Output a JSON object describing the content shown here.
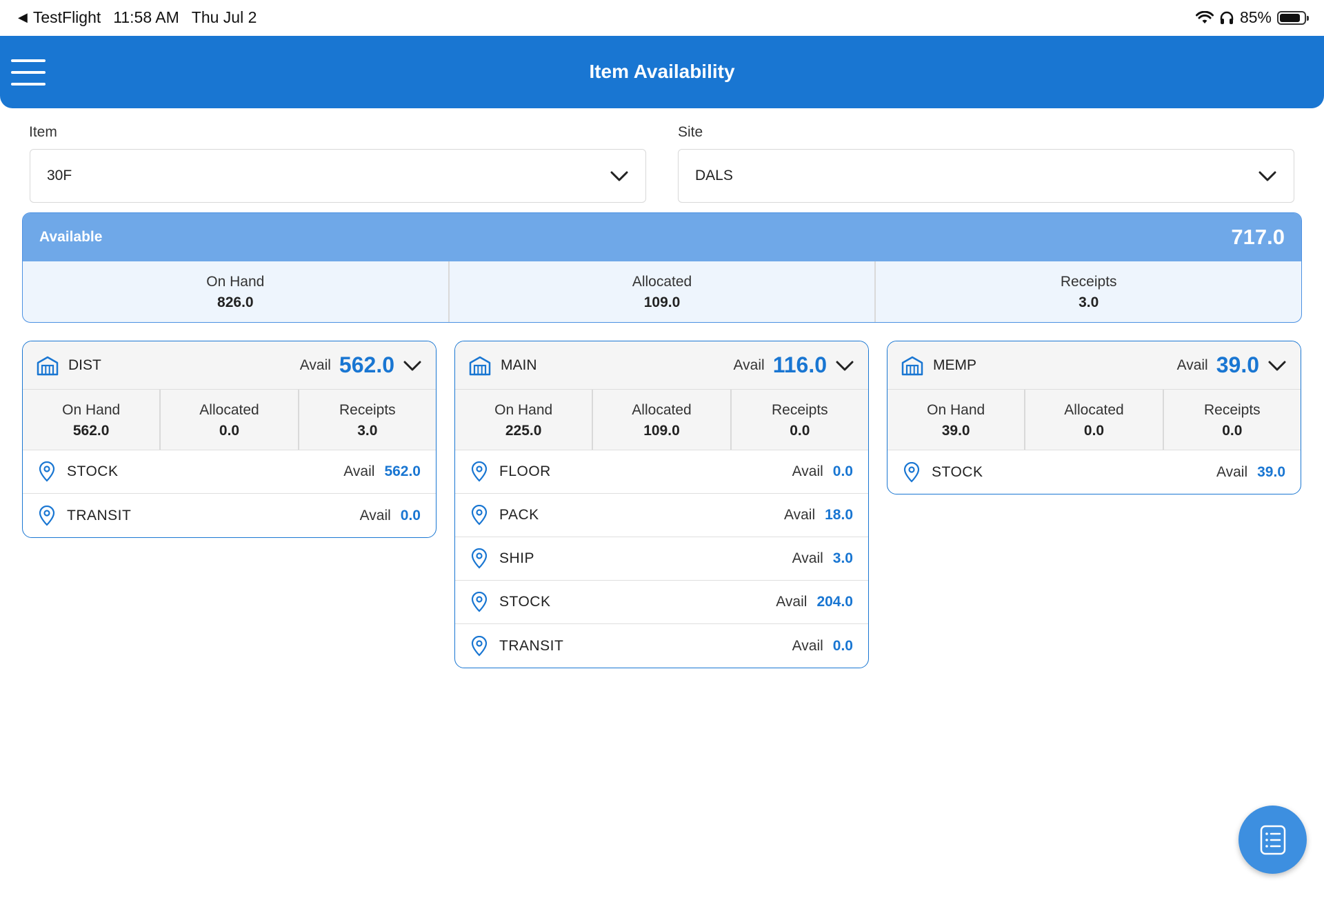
{
  "status_bar": {
    "back_app": "TestFlight",
    "time": "11:58 AM",
    "date": "Thu Jul 2",
    "battery": "85%",
    "battery_level": 0.85
  },
  "header": {
    "title": "Item Availability"
  },
  "filters": {
    "item_label": "Item",
    "item_value": "30F",
    "site_label": "Site",
    "site_value": "DALS"
  },
  "summary": {
    "label": "Available",
    "value": "717.0",
    "columns": [
      {
        "label": "On Hand",
        "value": "826.0"
      },
      {
        "label": "Allocated",
        "value": "109.0"
      },
      {
        "label": "Receipts",
        "value": "3.0"
      }
    ]
  },
  "avail_label": "Avail",
  "sites": [
    {
      "name": "DIST",
      "avail": "562.0",
      "columns": [
        {
          "label": "On Hand",
          "value": "562.0"
        },
        {
          "label": "Allocated",
          "value": "0.0"
        },
        {
          "label": "Receipts",
          "value": "3.0"
        }
      ],
      "locations": [
        {
          "name": "STOCK",
          "avail": "562.0"
        },
        {
          "name": "TRANSIT",
          "avail": "0.0"
        }
      ]
    },
    {
      "name": "MAIN",
      "avail": "116.0",
      "columns": [
        {
          "label": "On Hand",
          "value": "225.0"
        },
        {
          "label": "Allocated",
          "value": "109.0"
        },
        {
          "label": "Receipts",
          "value": "0.0"
        }
      ],
      "locations": [
        {
          "name": "FLOOR",
          "avail": "0.0"
        },
        {
          "name": "PACK",
          "avail": "18.0"
        },
        {
          "name": "SHIP",
          "avail": "3.0"
        },
        {
          "name": "STOCK",
          "avail": "204.0"
        },
        {
          "name": "TRANSIT",
          "avail": "0.0"
        }
      ]
    },
    {
      "name": "MEMP",
      "avail": "39.0",
      "columns": [
        {
          "label": "On Hand",
          "value": "39.0"
        },
        {
          "label": "Allocated",
          "value": "0.0"
        },
        {
          "label": "Receipts",
          "value": "0.0"
        }
      ],
      "locations": [
        {
          "name": "STOCK",
          "avail": "39.0"
        }
      ]
    }
  ],
  "icons": {
    "menu": "hamburger-menu-icon",
    "warehouse": "warehouse-icon",
    "location": "location-pin-icon",
    "fab": "list-document-icon"
  },
  "colors": {
    "primary": "#1976d2",
    "summary_header": "#6fa8e8",
    "fab": "#3d8fe0"
  }
}
